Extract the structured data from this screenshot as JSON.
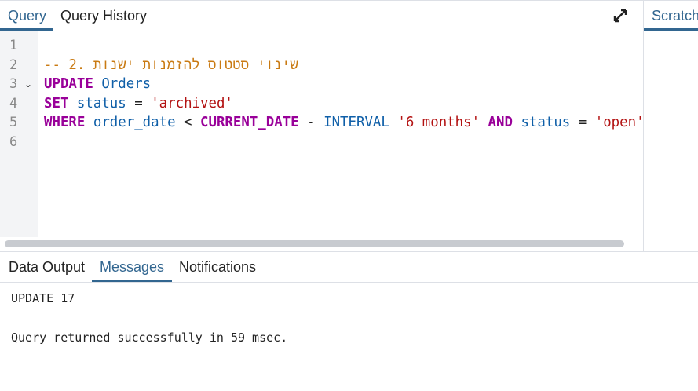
{
  "editor_tabs": {
    "query": "Query",
    "history": "Query History"
  },
  "scratch_tab": "Scratch",
  "line_numbers": [
    "1",
    "2",
    "3",
    "4",
    "5",
    "6"
  ],
  "code": {
    "comment": "-- 2. שינוי סטטוס להזמנות ישנות",
    "l3": {
      "kw": "UPDATE",
      "table": "Orders"
    },
    "l4": {
      "kw": "SET",
      "col": "status",
      "eq": "=",
      "val": "'archived'"
    },
    "l5": {
      "kw": "WHERE",
      "col": "order_date",
      "lt": "<",
      "fn": "CURRENT_DATE",
      "minus": "-",
      "interval": "INTERVAL",
      "ival": "'6 months'",
      "and": "AND",
      "col2": "status",
      "eq": "=",
      "val": "'open'"
    }
  },
  "output_tabs": {
    "data": "Data Output",
    "messages": "Messages",
    "notifications": "Notifications"
  },
  "messages": {
    "line1": "UPDATE 17",
    "line2": "Query returned successfully in 59 msec."
  }
}
